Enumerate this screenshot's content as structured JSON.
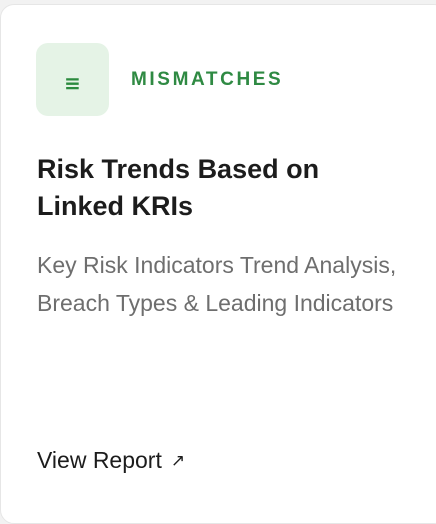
{
  "card": {
    "icon": {
      "name": "list-icon",
      "glyph": "≡",
      "tile_color": "#e5f3e6",
      "glyph_color": "#2b8a3e"
    },
    "category": "MISMATCHES",
    "category_color": "#2f8a43",
    "title": "Risk Trends Based on Linked KRIs",
    "description": "Key Risk Indicators Trend Analysis, Breach Types & Leading Indicators",
    "link": {
      "label": "View Report",
      "arrow": "↗"
    }
  }
}
